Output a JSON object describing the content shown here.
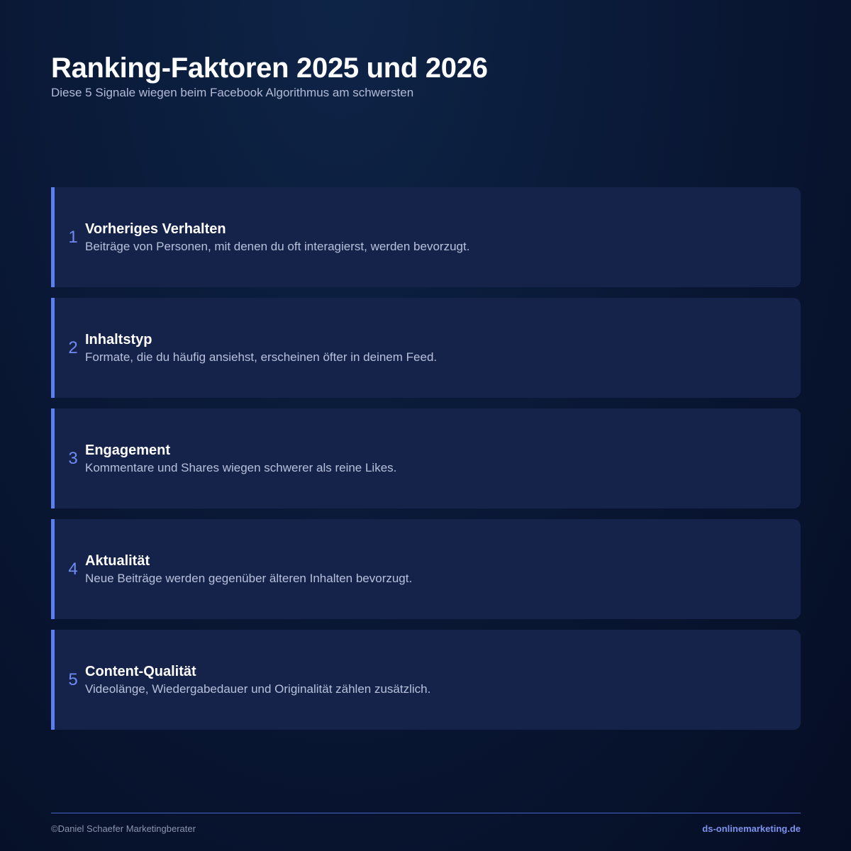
{
  "header": {
    "title": "Ranking-Faktoren 2025 und 2026",
    "subtitle": "Diese 5 Signale wiegen beim Facebook Algorithmus am schwersten"
  },
  "factors": [
    {
      "number": "1",
      "title": "Vorheriges Verhalten",
      "description": "Beiträge von Personen, mit denen du oft interagierst, werden bevorzugt."
    },
    {
      "number": "2",
      "title": "Inhaltstyp",
      "description": "Formate, die du häufig ansiehst, erscheinen öfter in deinem Feed."
    },
    {
      "number": "3",
      "title": "Engagement",
      "description": "Kommentare und Shares wiegen schwerer als reine Likes."
    },
    {
      "number": "4",
      "title": "Aktualität",
      "description": "Neue Beiträge werden gegenüber älteren Inhalten bevorzugt."
    },
    {
      "number": "5",
      "title": "Content-Qualität",
      "description": "Videolänge, Wiedergabedauer und Originalität zählen zusätzlich."
    }
  ],
  "footer": {
    "copyright": "©Daniel Schaefer Marketingberater",
    "website": "ds-onlinemarketing.de"
  },
  "colors": {
    "accent": "#5b7ff0",
    "card_background": "#152249",
    "page_background": "#0a1a38"
  }
}
